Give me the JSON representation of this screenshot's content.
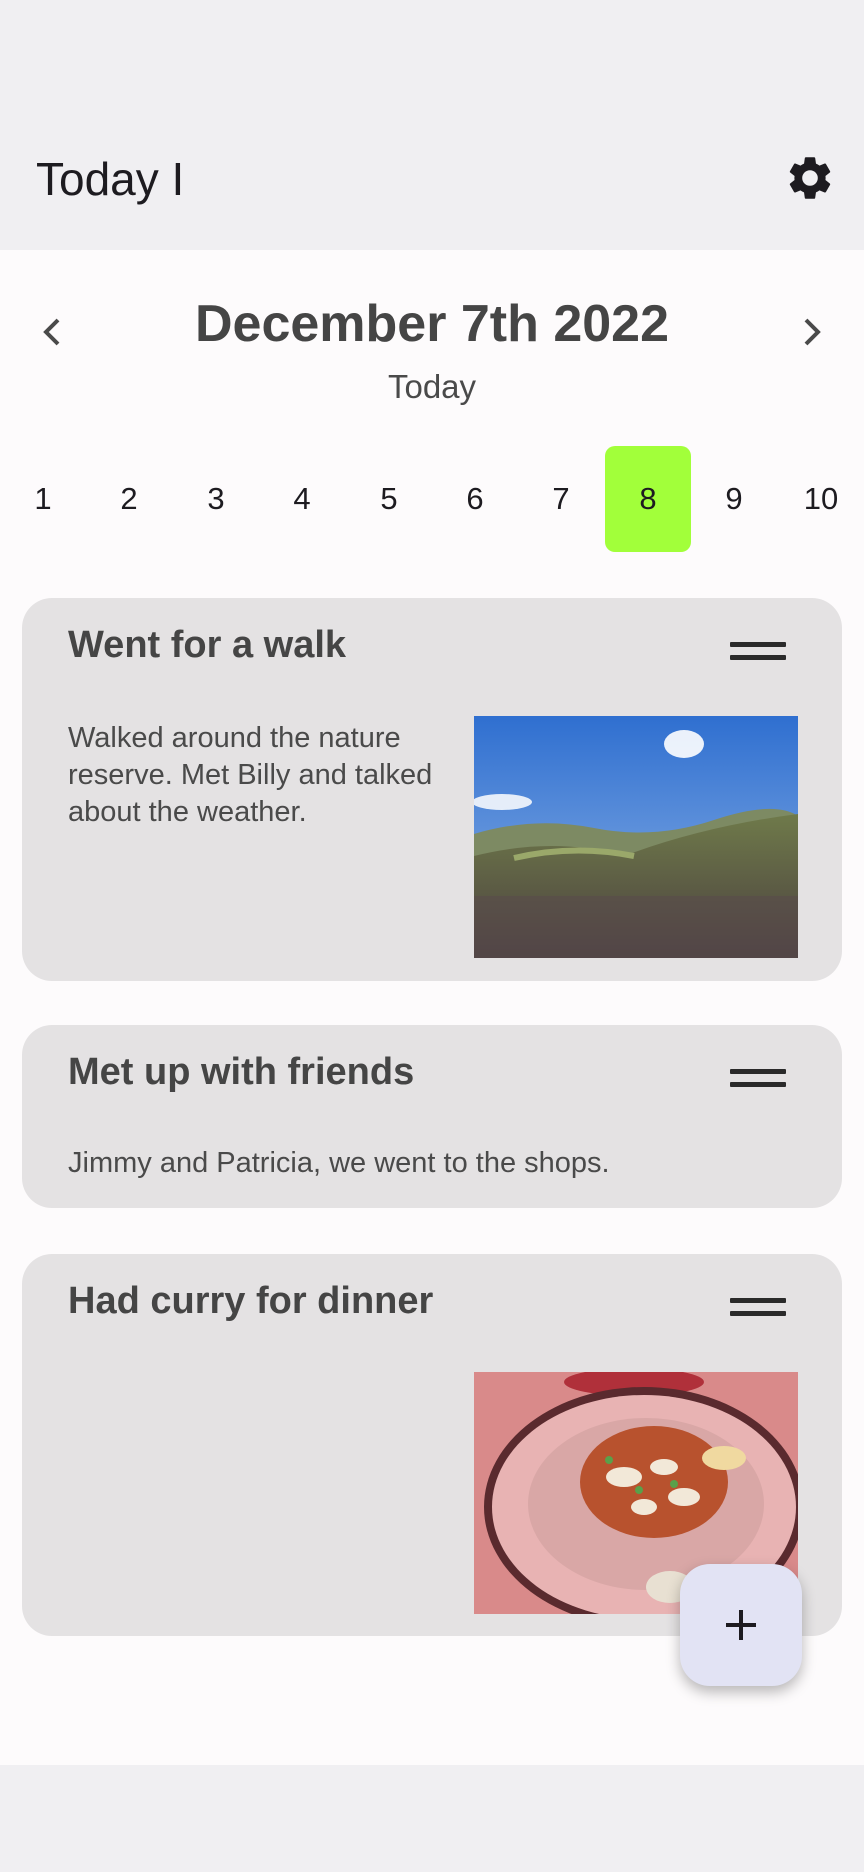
{
  "app": {
    "title": "Today I"
  },
  "date_nav": {
    "date": "December 7th 2022",
    "relative": "Today",
    "days": [
      "1",
      "2",
      "3",
      "4",
      "5",
      "6",
      "7",
      "8",
      "9",
      "10"
    ],
    "selected_day": "8"
  },
  "entries": [
    {
      "title": "Went for a walk",
      "text": "Walked around the nature reserve. Met Billy and talked about the weather.",
      "has_photo": true,
      "photo": "landscape-photo"
    },
    {
      "title": "Met up with friends",
      "text": "Jimmy and Patricia, we went to the shops.",
      "has_photo": false
    },
    {
      "title": "Had curry for dinner",
      "text": "",
      "has_photo": true,
      "photo": "curry-photo"
    }
  ],
  "icons": {
    "settings": "gear-icon",
    "prev": "chevron-left-icon",
    "next": "chevron-right-icon",
    "drag": "drag-handle-icon",
    "add": "plus-icon"
  },
  "colors": {
    "selected_day": "#a2ff3a",
    "card_background": "#e4e2e3",
    "fab_background": "#e2e3f4"
  }
}
